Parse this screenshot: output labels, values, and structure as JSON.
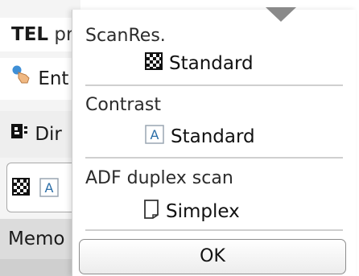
{
  "background": {
    "tel_label": "TEL",
    "tel_partial": "pr",
    "enter_partial": "Ent",
    "directory_partial": "Dir",
    "memory_partial": "Memo"
  },
  "dialog": {
    "settings": [
      {
        "title": "ScanRes.",
        "value": "Standard",
        "icon": "checker-icon"
      },
      {
        "title": "Contrast",
        "value": "Standard",
        "icon": "contrast-a-icon"
      },
      {
        "title": "ADF duplex scan",
        "value": "Simplex",
        "icon": "page-icon"
      }
    ],
    "ok_label": "OK"
  },
  "colors": {
    "text": "#111111",
    "divider": "#cfcfcf",
    "contrast_icon_blue": "#2b6ea8"
  }
}
